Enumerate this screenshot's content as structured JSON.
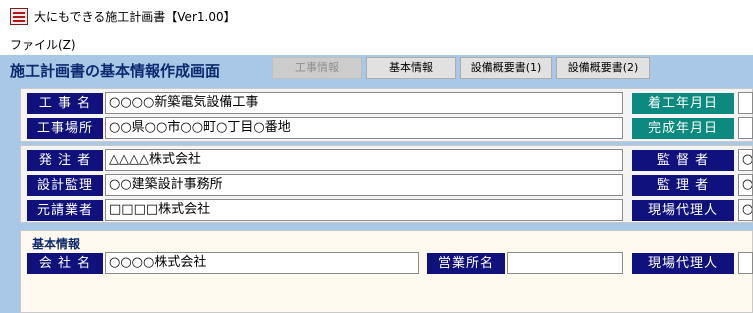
{
  "window": {
    "title": "大にもできる施工計画書【Ver1.00】"
  },
  "menu": {
    "file": "ファイル(Z)"
  },
  "page": {
    "heading": "施工計画書の基本情報作成画面"
  },
  "tabs": [
    {
      "label": "工事情報",
      "enabled": false
    },
    {
      "label": "基本情報",
      "enabled": true
    },
    {
      "label": "設備概要書(1)",
      "enabled": true
    },
    {
      "label": "設備概要書(2)",
      "enabled": true
    }
  ],
  "project": {
    "name_label": "工 事 名",
    "name_value": "○○○○新築電気設備工事",
    "site_label": "工事場所",
    "site_value": "○○県○○市○○町○丁目○番地",
    "start_label": "着工年月日",
    "start_value": "",
    "end_label": "完成年月日",
    "end_value": ""
  },
  "parties": {
    "client_label": "発 注 者",
    "client_value": "△△△△株式会社",
    "designer_label": "設計監理",
    "designer_value": "○○建築設計事務所",
    "contractor_label": "元請業者",
    "contractor_value": "□□□□株式会社",
    "supervisor_label": "監 督 者",
    "supervisor_value": "○",
    "manager_label": "監 理 者",
    "manager_value": "○",
    "site_agent_label": "現場代理人",
    "site_agent_value": "○"
  },
  "basic": {
    "section_title": "基本情報",
    "company_label": "会 社 名",
    "company_value": "○○○○株式会社",
    "office_label": "営業所名",
    "office_value": "",
    "agent_label": "現場代理人",
    "agent_value": ""
  },
  "colors": {
    "label_navy": "#11117d",
    "label_teal": "#0d8a7f",
    "panel_blue": "#a9c7e6"
  }
}
